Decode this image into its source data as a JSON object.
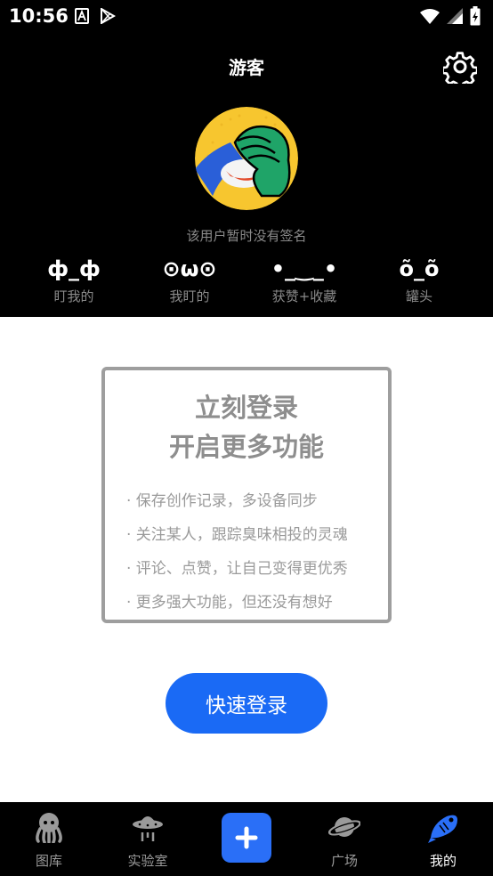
{
  "status_bar": {
    "time": "10:56"
  },
  "header": {
    "title": "游客",
    "signature": "该用户暂时没有签名"
  },
  "stats": [
    {
      "value": "ф_ф",
      "label": "盯我的"
    },
    {
      "value": "⊙ω⊙",
      "label": "我盯的"
    },
    {
      "value": "•_‿_•",
      "label": "获赞+收藏"
    },
    {
      "value": "õ_õ",
      "label": "罐头"
    }
  ],
  "login_card": {
    "heading_1": "立刻登录",
    "heading_2": "开启更多功能",
    "features": [
      "· 保存创作记录，多设备同步",
      "· 关注某人，跟踪臭味相投的灵魂",
      "· 评论、点赞，让自己变得更优秀",
      "· 更多强大功能，但还没有想好"
    ]
  },
  "login_button": {
    "label": "快速登录"
  },
  "nav": {
    "items": [
      {
        "label": "图库",
        "icon": "octopus-icon"
      },
      {
        "label": "实验室",
        "icon": "ufo-icon"
      },
      {
        "label": "",
        "icon": "plus-icon"
      },
      {
        "label": "广场",
        "icon": "planet-icon"
      },
      {
        "label": "我的",
        "icon": "fish-icon"
      }
    ],
    "active": "我的"
  },
  "colors": {
    "accent": "#1a6af5",
    "background_dark": "#000000",
    "muted_text": "#8a8a8a"
  }
}
